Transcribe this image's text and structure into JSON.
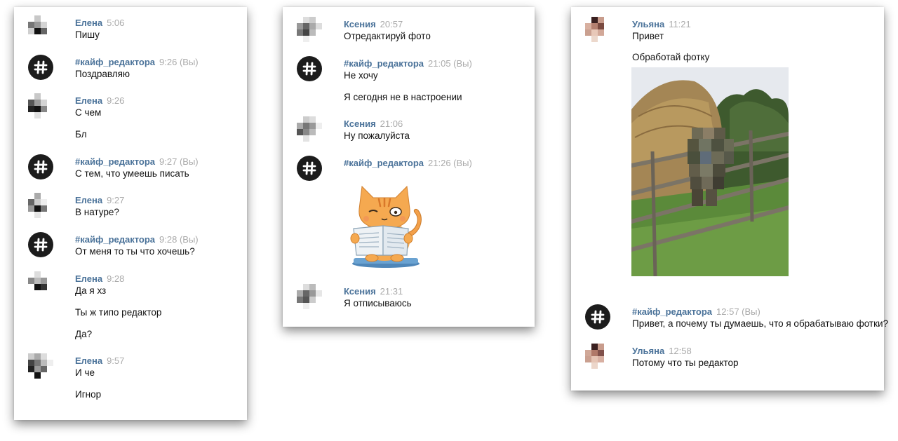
{
  "chat_left": {
    "messages": [
      {
        "author": "Елена",
        "time": "5:06",
        "lines": [
          "Пишу"
        ]
      },
      {
        "author": "#кайф_редактора",
        "time": "9:26 (Вы)",
        "lines": [
          "Поздравляю"
        ]
      },
      {
        "author": "Елена",
        "time": "9:26",
        "lines": [
          "С чем",
          "Бл"
        ]
      },
      {
        "author": "#кайф_редактора",
        "time": "9:27 (Вы)",
        "lines": [
          "С тем, что умеешь писать"
        ]
      },
      {
        "author": "Елена",
        "time": "9:27",
        "lines": [
          "В натуре?"
        ]
      },
      {
        "author": "#кайф_редактора",
        "time": "9:28 (Вы)",
        "lines": [
          "От меня то ты что хочешь?"
        ]
      },
      {
        "author": "Елена",
        "time": "9:28",
        "lines": [
          "Да я хз",
          "Ты ж типо редактор",
          "Да?"
        ]
      },
      {
        "author": "Елена",
        "time": "9:57",
        "lines": [
          "И че",
          "Игнор"
        ]
      }
    ]
  },
  "chat_middle": {
    "messages": [
      {
        "author": "Ксения",
        "time": "20:57",
        "lines": [
          "Отредактируй фото"
        ]
      },
      {
        "author": "#кайф_редактора",
        "time": "21:05 (Вы)",
        "lines": [
          "Не хочу",
          "Я сегодня не в настроении"
        ]
      },
      {
        "author": "Ксения",
        "time": "21:06",
        "lines": [
          "Ну пожалуйста"
        ]
      },
      {
        "author": "#кайф_редактора",
        "time": "21:26 (Вы)",
        "lines": []
      },
      {
        "author": "Ксения",
        "time": "21:31",
        "lines": [
          "Я отписываюсь"
        ]
      }
    ]
  },
  "chat_right": {
    "messages": [
      {
        "author": "Ульяна",
        "time": "11:21",
        "lines": [
          "Привет",
          "Обработай фотку"
        ]
      },
      {
        "author": "#кайф_редактора",
        "time": "12:57 (Вы)",
        "lines": [
          "Привет, а почему ты думаешь, что я обрабатываю фотки?"
        ]
      },
      {
        "author": "Ульяна",
        "time": "12:58",
        "lines": [
          "Потому что ты редактор"
        ]
      }
    ]
  },
  "icons": {
    "hash_avatar": "hashtag-icon",
    "user_avatar": "pixelated-avatar-icon",
    "sticker": "cat-reading-newspaper-sticker",
    "photo": "haystack-fence-photo"
  },
  "colors": {
    "author": "#4a7299",
    "time": "#aaaaaa",
    "hash_avatar_bg": "#1c1c1c"
  }
}
